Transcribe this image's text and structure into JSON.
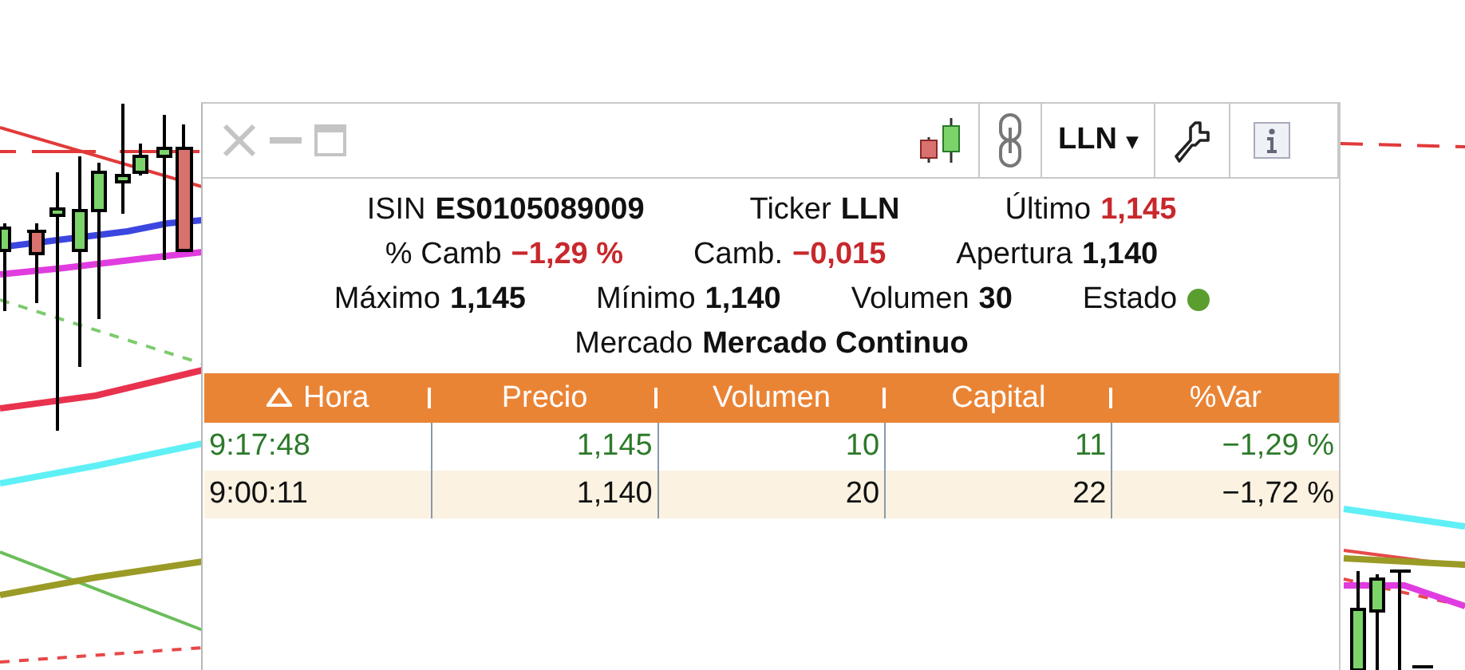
{
  "toolbar": {
    "window_controls_disabled": true,
    "ticker_menu": {
      "label": "LLN",
      "caret": "▾"
    }
  },
  "info_rows": [
    [
      {
        "label": "ISIN",
        "value": "ES0105089009",
        "negative": false
      },
      {
        "label": "Ticker",
        "value": "LLN",
        "negative": false
      },
      {
        "label": "Último",
        "value": "1,145",
        "negative": true
      }
    ],
    [
      {
        "label": "% Camb",
        "value": "−1,29 %",
        "negative": true
      },
      {
        "label": "Camb.",
        "value": "−0,015",
        "negative": true
      },
      {
        "label": "Apertura",
        "value": "1,140",
        "negative": false
      }
    ],
    [
      {
        "label": "Máximo",
        "value": "1,145",
        "negative": false
      },
      {
        "label": "Mínimo",
        "value": "1,140",
        "negative": false
      },
      {
        "label": "Volumen",
        "value": "30",
        "negative": false
      },
      {
        "label": "Estado",
        "kind": "status",
        "color": "#5a9e2f"
      }
    ],
    [
      {
        "label": "Mercado",
        "value": "Mercado Continuo",
        "negative": false
      }
    ]
  ],
  "table": {
    "columns": [
      {
        "label": "Hora",
        "sorted": true
      },
      {
        "label": "Precio",
        "sorted": false
      },
      {
        "label": "Volumen",
        "sorted": false
      },
      {
        "label": "Capital",
        "sorted": false
      },
      {
        "label": "%Var",
        "sorted": false
      }
    ],
    "rows": [
      {
        "cells": [
          "9:17:48",
          "1,145",
          "10",
          "11",
          "−1,29 %"
        ],
        "highlighted": true
      },
      {
        "cells": [
          "9:00:11",
          "1,140",
          "20",
          "22",
          "−1,72 %"
        ],
        "highlighted": false
      }
    ]
  }
}
